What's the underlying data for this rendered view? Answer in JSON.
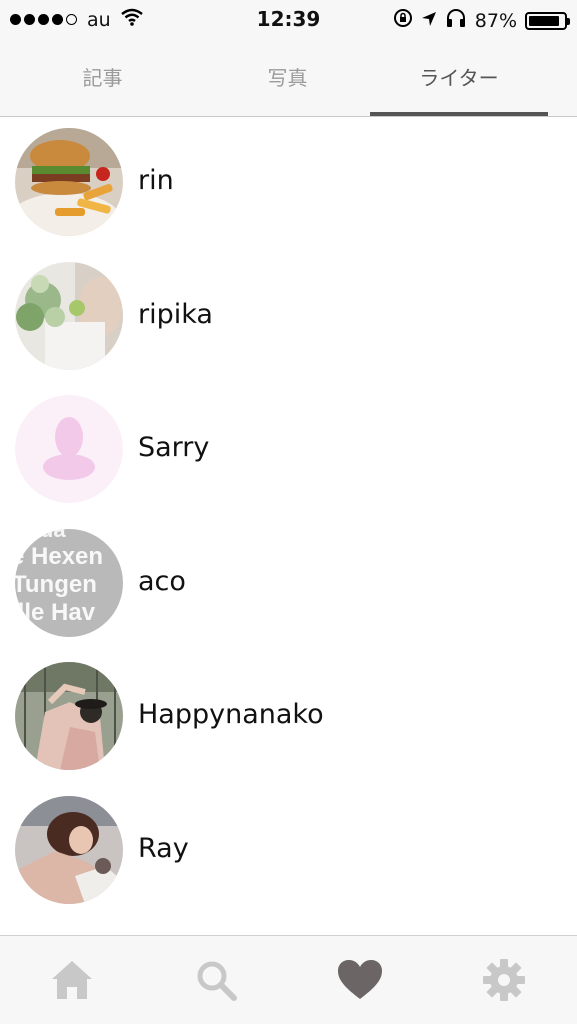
{
  "status_bar": {
    "carrier": "au",
    "time": "12:39",
    "battery": "87%",
    "battery_level": 0.87
  },
  "tabs": [
    {
      "label": "記事",
      "active": false
    },
    {
      "label": "写真",
      "active": false
    },
    {
      "label": "ライター",
      "active": true
    }
  ],
  "writers": [
    {
      "name": "rin"
    },
    {
      "name": "ripika"
    },
    {
      "name": "Sarry"
    },
    {
      "name": "aco"
    },
    {
      "name": "Happynanako"
    },
    {
      "name": "Ray"
    }
  ],
  "avatar_text_lines": [
    "ar da",
    "e Hexen",
    "Tungen",
    "ille Hav"
  ],
  "bottom_nav": [
    {
      "icon": "home-icon",
      "active": false
    },
    {
      "icon": "search-icon",
      "active": false
    },
    {
      "icon": "heart-icon",
      "active": true
    },
    {
      "icon": "gear-icon",
      "active": false
    }
  ],
  "colors": {
    "inactive": "#c8c8c8",
    "active": "#6b6566",
    "bar_background": "#f7f7f7",
    "default_avatar_bg": "#fbeff8",
    "default_avatar_figure": "#f3c9ea"
  }
}
